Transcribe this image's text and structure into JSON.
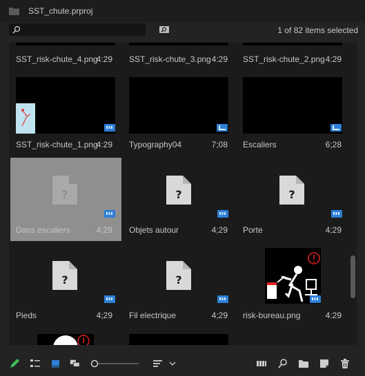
{
  "window": {
    "title": "SST_chute.prproj"
  },
  "search": {
    "placeholder": "",
    "status": "1 of 82 items selected"
  },
  "items": [
    {
      "name": "SST_risk-chute_4.png",
      "duration": "4:29"
    },
    {
      "name": "SST_risk-chute_3.png",
      "duration": "4:29"
    },
    {
      "name": "SST_risk-chute_2.png",
      "duration": "4:29"
    },
    {
      "name": "SST_risk-chute_1.png",
      "duration": "4:29"
    },
    {
      "name": "Typography04",
      "duration": "7;08"
    },
    {
      "name": "Escaliers",
      "duration": "6;28"
    },
    {
      "name": "Dans escaliers",
      "duration": "4;29",
      "selected": true
    },
    {
      "name": "Objets autour",
      "duration": "4;29"
    },
    {
      "name": "Porte",
      "duration": "4;29"
    },
    {
      "name": "Pieds",
      "duration": "4;29"
    },
    {
      "name": "Fil electrique",
      "duration": "4;29"
    },
    {
      "name": "risk-bureau.png",
      "duration": "4:29"
    }
  ],
  "toolbar": {
    "icons": [
      "pencil-icon",
      "list-view-icon",
      "icon-view-icon",
      "freeform-view-icon",
      "zoom-slider",
      "sort-icon",
      "automate-sequence-icon",
      "find-icon",
      "new-bin-icon",
      "new-item-icon",
      "trash-icon"
    ]
  },
  "colors": {
    "accent": "#2d7fd7",
    "selection": "#8f8f8f",
    "pencil": "#3fc25a",
    "warning": "#e02020"
  }
}
